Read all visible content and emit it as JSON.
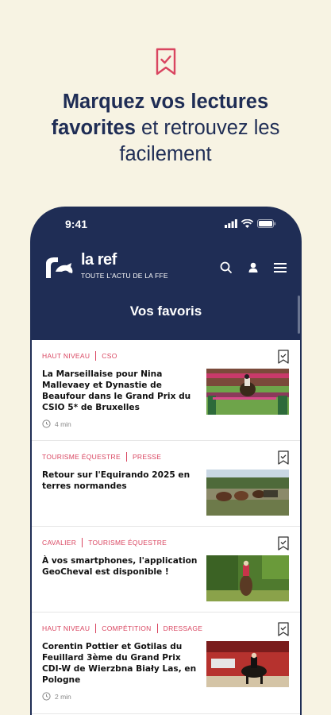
{
  "promo": {
    "headline_bold_1": "Marquez vos lectures",
    "headline_bold_2": "favorites",
    "headline_light_2": "et retrouvez les",
    "headline_light_3": "facilement",
    "icon": "bookmark-check-icon",
    "accent_color": "#d94560",
    "text_color": "#1f2d55",
    "background": "#f7f3e3"
  },
  "status_bar": {
    "time": "9:41"
  },
  "app": {
    "name": "la ref",
    "tagline": "TOUTE L'ACTU DE LA FFE",
    "primary_color": "#1f2d55",
    "page_title": "Vos favoris"
  },
  "articles": [
    {
      "categories": [
        "HAUT NIVEAU",
        "CSO"
      ],
      "title": "La Marseillaise pour Nina Mallevaey et Dynastie de Beaufour dans le Grand Prix du CSIO 5* de Bruxelles",
      "read_time": "4 min"
    },
    {
      "categories": [
        "TOURISME ÉQUESTRE",
        "PRESSE"
      ],
      "title": "Retour sur l'Equirando 2025 en terres normandes",
      "read_time": ""
    },
    {
      "categories": [
        "CAVALIER",
        "TOURISME ÉQUESTRE"
      ],
      "title": "À vos smartphones, l'application GeoCheval est disponible !",
      "read_time": ""
    },
    {
      "categories": [
        "HAUT NIVEAU",
        "COMPÉTITION",
        "DRESSAGE"
      ],
      "title": "Corentin Pottier et Gotilas du Feuillard 3ème du Grand Prix CDI-W de Wierzbna Biały Las, en Pologne",
      "read_time": "2 min"
    }
  ]
}
